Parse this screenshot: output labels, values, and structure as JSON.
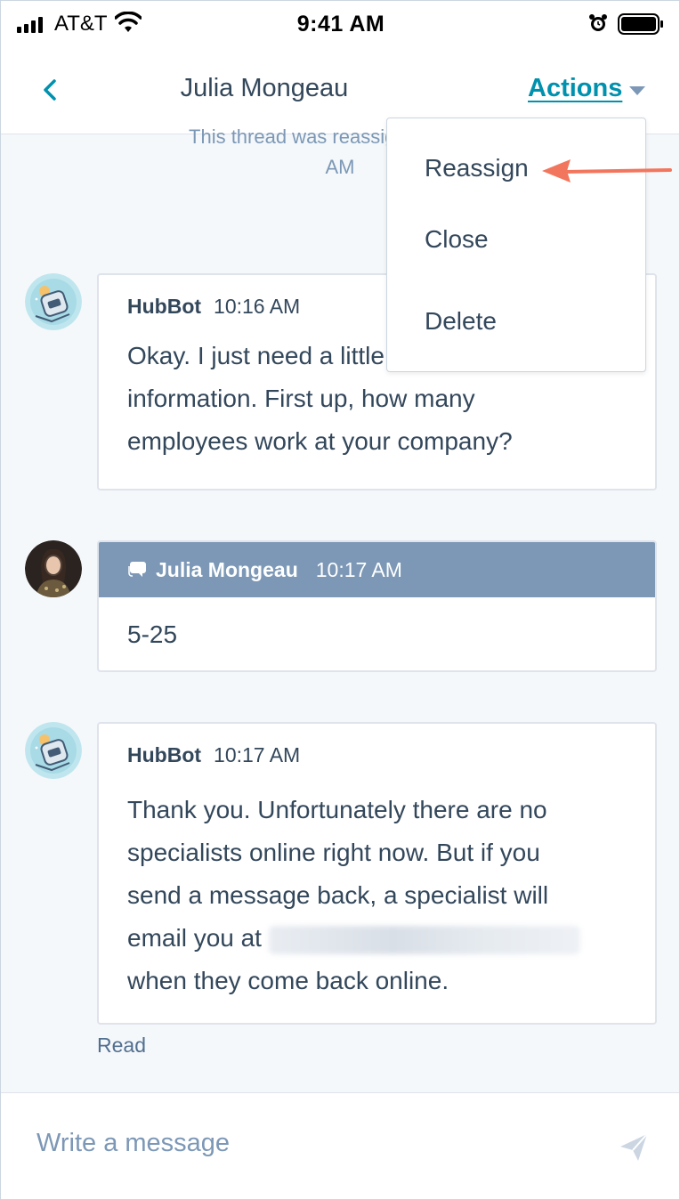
{
  "status_bar": {
    "carrier": "AT&T",
    "time": "9:41 AM",
    "icons": [
      "signal-icon",
      "wifi-icon",
      "alarm-icon",
      "battery-icon"
    ]
  },
  "header": {
    "title": "Julia Mongeau",
    "actions_label": "Actions"
  },
  "thread": {
    "system_message_line1": "This thread was reassigned to Hub",
    "system_message_line2": "AM",
    "messages": [
      {
        "sender": "HubBot",
        "time": "10:16 AM",
        "lines": [
          "Okay. I just need a little bit of",
          "information. First up, how many",
          "employees work at your company?"
        ]
      },
      {
        "sender": "Julia Mongeau",
        "time": "10:17 AM",
        "text": "5-25"
      },
      {
        "sender": "HubBot",
        "time": "10:17 AM",
        "lines": [
          "Thank you. Unfortunately there are no",
          "specialists online right now. But if you",
          "send a message back, a specialist will",
          "email you at",
          "when they come back online."
        ]
      }
    ],
    "read_status": "Read"
  },
  "composer": {
    "placeholder": "Write a message"
  },
  "dropdown": {
    "items": [
      "Reassign",
      "Close",
      "Delete"
    ]
  },
  "colors": {
    "accent": "#0091ae",
    "visitor_header": "#7c98b6",
    "annotation_arrow": "#f2765e",
    "text": "#33475b"
  }
}
